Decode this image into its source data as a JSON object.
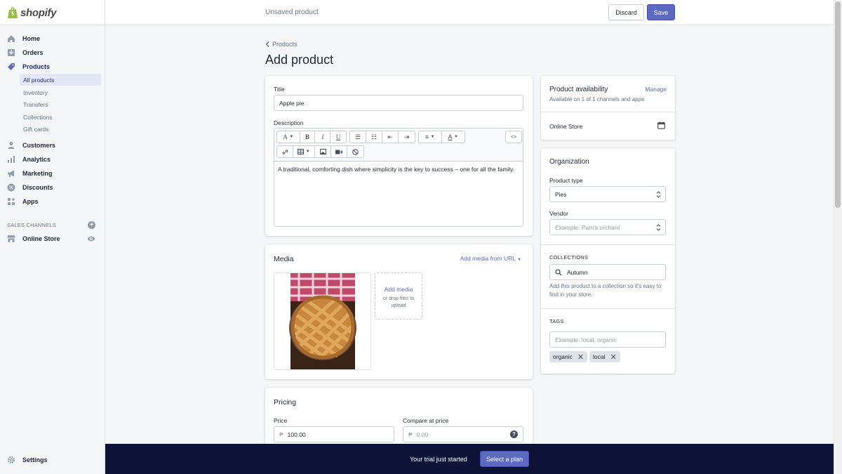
{
  "app": {
    "brand": "shopify"
  },
  "topbar": {
    "title": "Unsaved product",
    "discard_label": "Discard",
    "save_label": "Save"
  },
  "sidebar": {
    "items": [
      {
        "label": "Home",
        "icon": "home-icon"
      },
      {
        "label": "Orders",
        "icon": "orders-icon"
      },
      {
        "label": "Products",
        "icon": "tag-icon"
      },
      {
        "label": "Customers",
        "icon": "customers-icon"
      },
      {
        "label": "Analytics",
        "icon": "analytics-icon"
      },
      {
        "label": "Marketing",
        "icon": "marketing-icon"
      },
      {
        "label": "Discounts",
        "icon": "discount-icon"
      },
      {
        "label": "Apps",
        "icon": "apps-icon"
      }
    ],
    "product_subitems": [
      "All products",
      "Inventory",
      "Transfers",
      "Collections",
      "Gift cards"
    ],
    "sales_channels_heading": "SALES CHANNELS",
    "online_store": "Online Store",
    "settings": "Settings"
  },
  "page": {
    "breadcrumb": "Products",
    "title": "Add product"
  },
  "product": {
    "title_label": "Title",
    "title_value": "Apple pie",
    "description_label": "Description",
    "description_text": "A traditional, comforting dish where simplicity is the key to success – one for all the family."
  },
  "media": {
    "heading": "Media",
    "add_from_url": "Add media from URL",
    "add_media": "Add media",
    "drop_hint": "or drop files to upload"
  },
  "pricing": {
    "heading": "Pricing",
    "price_label": "Price",
    "price_value": "100.00",
    "compare_label": "Compare at price",
    "compare_placeholder": "0.00",
    "currency_symbol": "₱"
  },
  "availability": {
    "heading": "Product availability",
    "manage": "Manage",
    "subtitle": "Available on 1 of 1 channels and apps",
    "channel": "Online Store"
  },
  "organization": {
    "heading": "Organization",
    "product_type_label": "Product type",
    "product_type_value": "Pies",
    "vendor_label": "Vendor",
    "vendor_placeholder": "Example: Pam's orchard",
    "collections_heading": "COLLECTIONS",
    "collections_value": "Autumn",
    "collections_help": "Add this product to a collection so it's easy to find in your store.",
    "tags_heading": "TAGS",
    "tags_placeholder": "Example: local, organic",
    "tags": [
      "organic",
      "local"
    ]
  },
  "banner": {
    "text": "Your trial just started",
    "button": "Select a plan"
  },
  "colors": {
    "accent": "#5c6ac4",
    "banner": "#0c1336",
    "sidebar_active": "#202e78"
  }
}
